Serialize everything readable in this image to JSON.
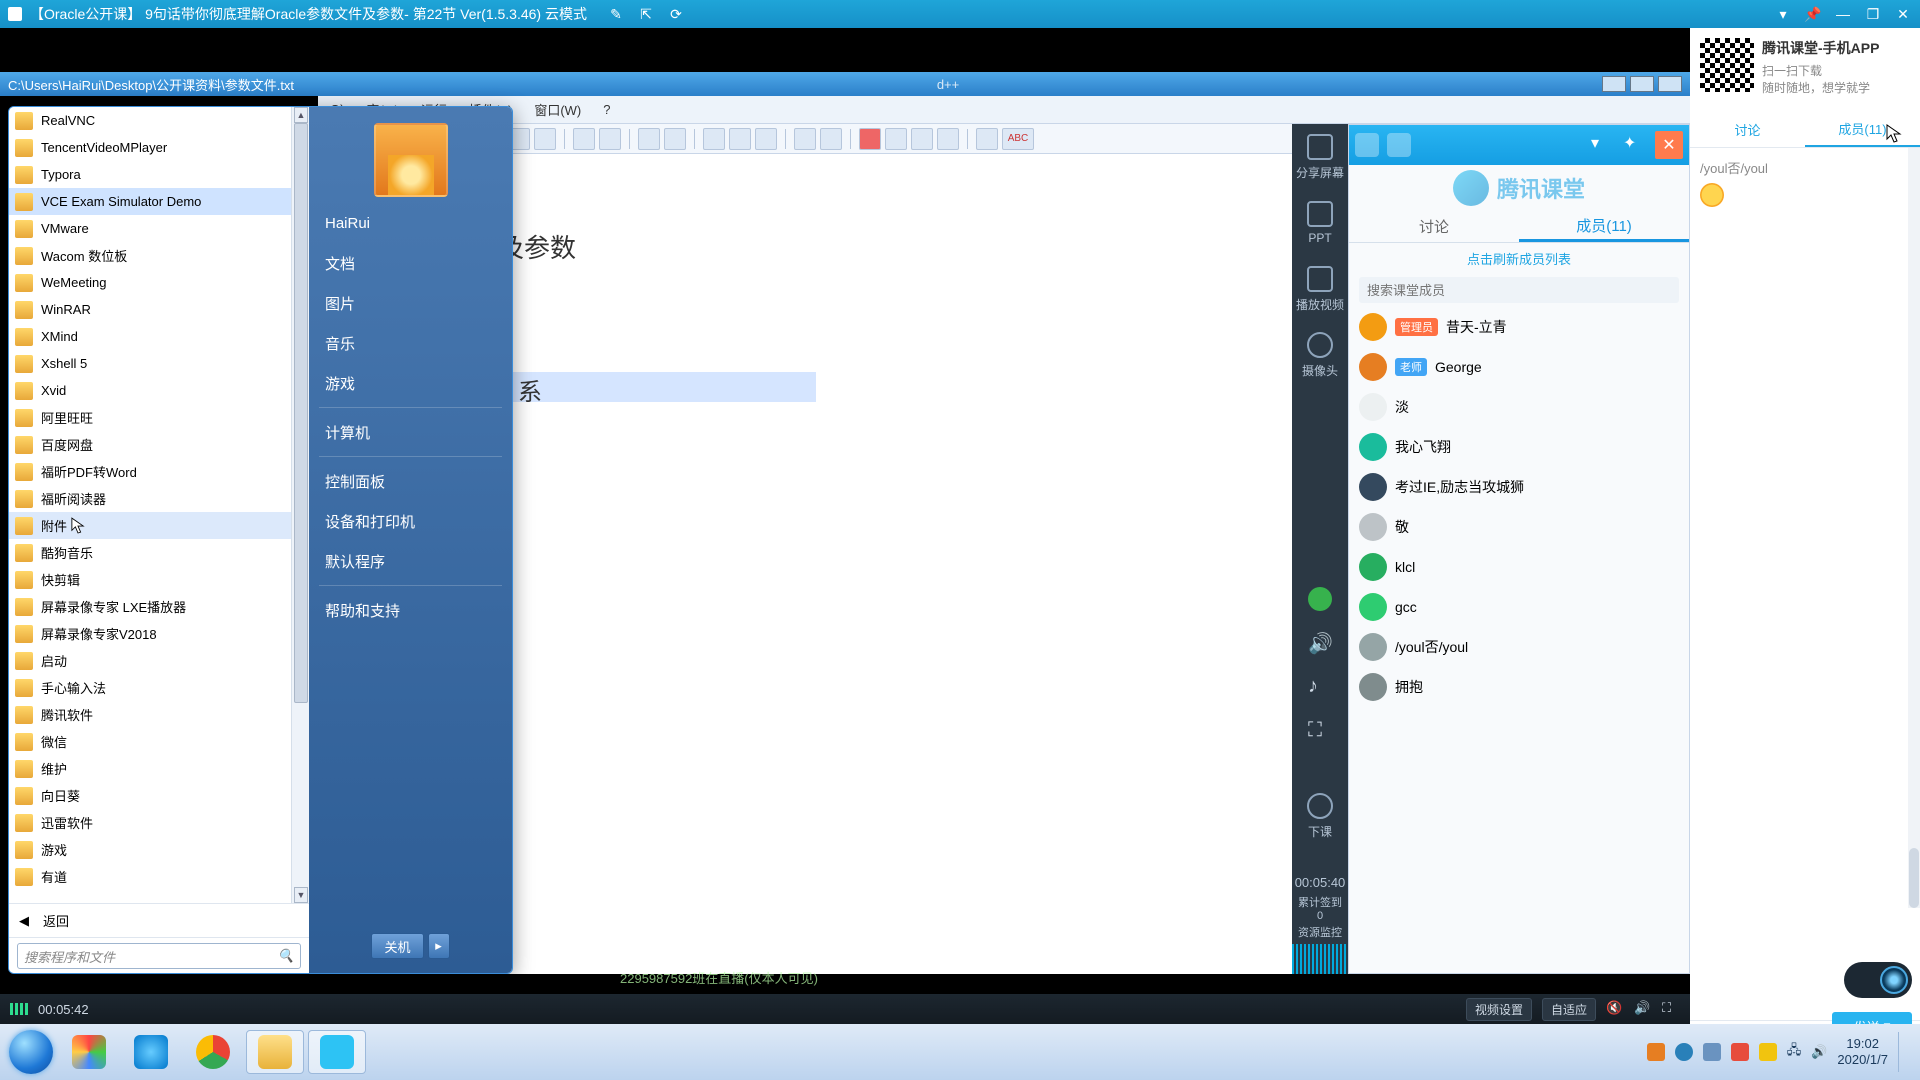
{
  "titlebar": {
    "title": "【Oracle公开课】 9句话带你彻底理解Oracle参数文件及参数- 第22节 Ver(1.5.3.46)  云模式",
    "btns": [
      "↗",
      "⇱",
      "⟳",
      "—",
      "▭",
      "❐",
      "✕"
    ]
  },
  "editor": {
    "path": "C:\\Users\\HaiRui\\Desktop\\公开课资料\\参数文件.txt",
    "tail": "d++",
    "menus": [
      "O)",
      "宏(M)",
      "运行",
      "插件(P)",
      "窗口(W)",
      "?"
    ],
    "abc": "ABC"
  },
  "content": {
    "l1": "及参数",
    "l2": "系"
  },
  "startmenu": {
    "programs": [
      "RealVNC",
      "TencentVideoMPlayer",
      "Typora",
      "VCE Exam Simulator Demo",
      "VMware",
      "Wacom 数位板",
      "WeMeeting",
      "WinRAR",
      "XMind",
      "Xshell 5",
      "Xvid",
      "阿里旺旺",
      "百度网盘",
      "福昕PDF转Word",
      "福昕阅读器",
      "附件",
      "酷狗音乐",
      "快剪辑",
      "屏幕录像专家 LXE播放器",
      "屏幕录像专家V2018",
      "启动",
      "手心输入法",
      "腾讯软件",
      "微信",
      "维护",
      "向日葵",
      "迅雷软件",
      "游戏",
      "有道"
    ],
    "selected_index": 3,
    "hover_index": 15,
    "back": "返回",
    "search_ph": "搜索程序和文件",
    "right_user": "HaiRui",
    "right_items": [
      "文档",
      "图片",
      "音乐",
      "游戏",
      "计算机",
      "控制面板",
      "设备和打印机",
      "默认程序",
      "帮助和支持"
    ],
    "shutdown": "关机"
  },
  "sidetools": {
    "items": [
      {
        "label": "分享屏幕"
      },
      {
        "label": "PPT"
      },
      {
        "label": "播放视频"
      },
      {
        "label": "摄像头"
      }
    ],
    "timer": "00:05:40",
    "stat1": "累计签到",
    "stat1n": "0",
    "stat2": "资源监控",
    "end": "下课"
  },
  "class": {
    "tabs": [
      "讨论",
      "成员(11)"
    ],
    "active_tab": 1,
    "refresh": "点击刷新成员列表",
    "search_ph": "搜索课堂成员",
    "members": [
      {
        "tag": "管理员",
        "tagc": "tg-red",
        "name": "昔天-立青"
      },
      {
        "tag": "老师",
        "tagc": "tg-blue",
        "name": "George"
      },
      {
        "tag": "",
        "tagc": "",
        "name": "淡"
      },
      {
        "tag": "",
        "tagc": "",
        "name": "我心飞翔"
      },
      {
        "tag": "",
        "tagc": "",
        "name": "考过IE,励志当攻城狮"
      },
      {
        "tag": "",
        "tagc": "",
        "name": "敬"
      },
      {
        "tag": "",
        "tagc": "",
        "name": "klcl"
      },
      {
        "tag": "",
        "tagc": "",
        "name": "gcc"
      },
      {
        "tag": "",
        "tagc": "",
        "name": "/youl否/youl"
      },
      {
        "tag": "",
        "tagc": "",
        "name": "拥抱"
      }
    ]
  },
  "rightstrip": {
    "app": "腾讯课堂-手机APP",
    "sub1": "扫一扫下载",
    "sub2": "随时随地，想学就学",
    "tabs": [
      "讨论",
      "成员(11)"
    ],
    "active": 1,
    "chat_line": "/youl否/youl",
    "send": "发送"
  },
  "vidbar": {
    "time": "00:05:42",
    "btns": [
      "视频设置",
      "自适应"
    ]
  },
  "status_float": "2295987592班在直播(仅本人可见)",
  "tray": {
    "time": "19:02",
    "date": "2020/1/7"
  }
}
